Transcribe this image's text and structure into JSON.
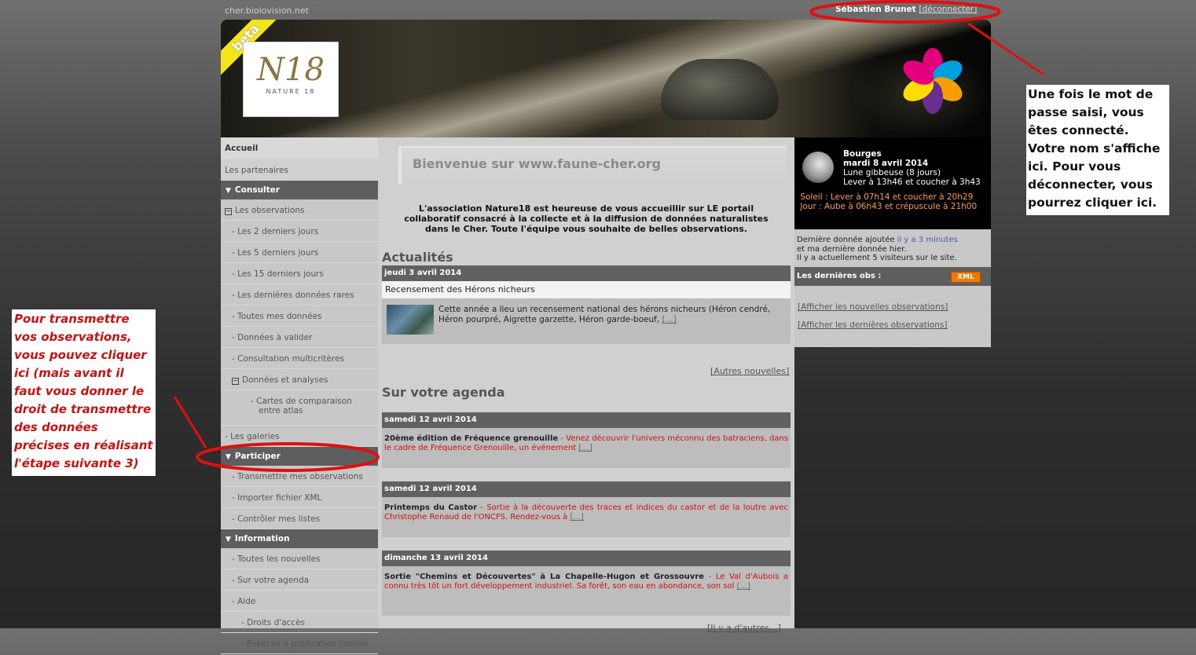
{
  "header": {
    "site_url": "cher.biolovision.net",
    "user_name": "Sébastien Brunet",
    "logout_label": "[déconnecter]"
  },
  "banner": {
    "beta": "beta",
    "logo_mark": "N18",
    "logo_caption": "NATURE 18",
    "flower_colors": [
      "#e4007c",
      "#00a0e0",
      "#f5a000",
      "#6c2d91",
      "#ffdd00",
      "#e4007c"
    ]
  },
  "sidebar": {
    "accueil": "Accueil",
    "partenaires": "Les partenaires",
    "consulter_head": "Consulter",
    "les_observations": "Les observations",
    "derniers_2": "- Les 2 derniers jours",
    "derniers_5": "- Les 5 derniers jours",
    "derniers_15": "- Les 15 derniers jours",
    "rares": "- Les dernières données rares",
    "toutes_mes": "- Toutes mes données",
    "a_valider": "- Données à valider",
    "multicriteres": "- Consultation multicritères",
    "analyses": "Données et analyses",
    "cartes_1": "- Cartes de comparaison",
    "cartes_2": "entre atlas",
    "galeries": "- Les galeries",
    "participer_head": "Participer",
    "transmettre": "- Transmettre mes observations",
    "importer": "- Importer fichier XML",
    "controler": "- Contrôler mes listes",
    "information_head": "Information",
    "nouvelles": "- Toutes les nouvelles",
    "agenda": "- Sur votre agenda",
    "aide": "- Aide",
    "droits": "- Droits d'accès",
    "especes": "- Espèces à publication limitée"
  },
  "center": {
    "welcome_title": "Bienvenue sur www.faune-cher.org",
    "intro": "L'association Nature18 est heureuse de vous accueillir sur LE portail collaboratif consacré à la collecte et à la diffusion de données naturalistes dans le Cher. Toute l'équipe vous souhaite de belles observations.",
    "news_title": "Actualités",
    "news_date": "jeudi 3 avril 2014",
    "news_headline": "Recensement des Hérons nicheurs",
    "news_text": "Cette année a lieu un recensement national des hérons nicheurs (Héron cendré, Héron pourpré, Aigrette garzette, Héron garde-boeuf, ",
    "more_link": "[...]",
    "other_news": "[Autres nouvelles]",
    "agenda_title": "Sur votre agenda",
    "events": [
      {
        "date": "samedi 12 avril 2014",
        "title": "20ème édition de Fréquence grenouille",
        "text": " - Venez découvrir l'univers méconnu des batraciens, dans le cadre de Fréquence Grenouille, un événement "
      },
      {
        "date": "samedi 12 avril 2014",
        "title": "Printemps du Castor",
        "text": " - Sortie à la découverte des traces et indices du castor et de la loutre avec Christophe Renaud de l'ONCFS. Rendez-vous à "
      },
      {
        "date": "dimanche 13 avril 2014",
        "title": "Sortie \"Chemins et Découvertes\" à La Chapelle-Hugon et Grossouvre",
        "text": " - Le Val d'Aubois a connu très tôt un fort développement industriel. Sa forêt, son eau en abondance, son sol "
      }
    ],
    "bottom_link": "[Il y a d'autres...]"
  },
  "right": {
    "city": "Bourges",
    "date": "mardi 8 avril 2014",
    "moon_phase": "Lune gibbeuse (8 jours)",
    "moon_rise": "Lever à 13h46 et coucher à 3h43",
    "sun": "Soleil : Lever à 07h14 et coucher à 20h29",
    "day": "Jour : Aube à 06h43 et crépuscule à 21h00",
    "last_data_prefix": "Dernière donnée ajoutée ",
    "last_data_link": "il y a 3 minutes",
    "my_last": "et ma dernière donnée hier.",
    "visitors": "Il y a actuellement 5 visiteurs sur le site.",
    "obs_head": "Les dernières obs :",
    "xml": "XML",
    "show_new": "[Afficher les nouvelles observations]",
    "show_last": "[Afficher les dernières observations]"
  },
  "annotations": {
    "right_note": "Une fois le mot de passe saisi, vous êtes connecté. Votre nom s'affiche ici. Pour vous déconnecter, vous pourrez cliquer ici.",
    "left_note": "Pour transmettre vos observations, vous pouvez cliquer ici (mais avant il faut vous donner le droit de transmettre des données précises en réalisant l'étape suivante 3)",
    "highlight_color": "#e01010"
  }
}
